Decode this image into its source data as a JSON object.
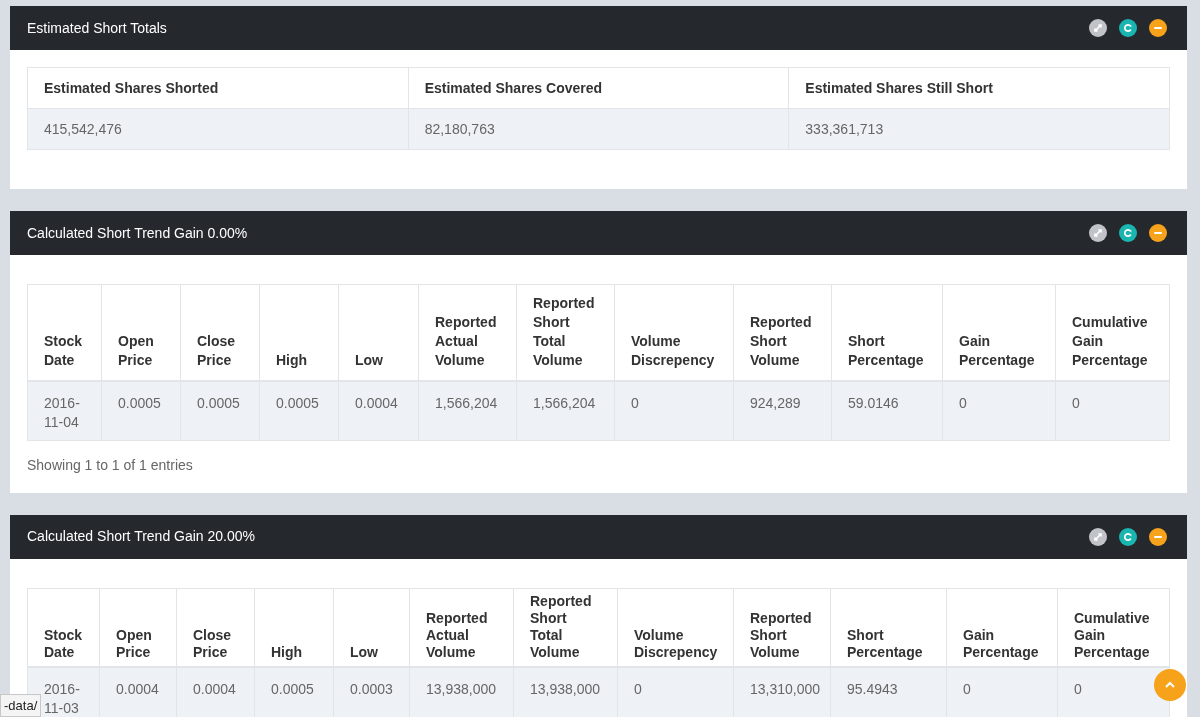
{
  "panels": [
    {
      "title": "Estimated Short Totals",
      "kind": "totals",
      "columns": [
        "Estimated Shares Shorted",
        "Estimated Shares Covered",
        "Estimated Shares Still Short"
      ],
      "rows": [
        [
          "415,542,476",
          "82,180,763",
          "333,361,713"
        ]
      ]
    },
    {
      "title": "Calculated Short Trend Gain 0.00%",
      "kind": "trend",
      "columns": [
        "Stock Date",
        "Open Price",
        "Close Price",
        "High",
        "Low",
        "Reported Actual Volume",
        "Reported Short Total Volume",
        "Volume Discrepency",
        "Reported Short Volume",
        "Short Percentage",
        "Gain Percentage",
        "Cumulative Gain Percentage"
      ],
      "rows": [
        [
          "2016-11-04",
          "0.0005",
          "0.0005",
          "0.0005",
          "0.0004",
          "1,566,204",
          "1,566,204",
          "0",
          "924,289",
          "59.0146",
          "0",
          "0"
        ]
      ],
      "footer": "Showing 1 to 1 of 1 entries"
    },
    {
      "title": "Calculated Short Trend Gain 20.00%",
      "kind": "trend",
      "columns": [
        "Stock Date",
        "Open Price",
        "Close Price",
        "High",
        "Low",
        "Reported Actual Volume",
        "Reported Short Total Volume",
        "Volume Discrepency",
        "Reported Short Volume",
        "Short Percentage",
        "Gain Percentage",
        "Cumulative Gain Percentage"
      ],
      "rows": [
        [
          "2016-11-03",
          "0.0004",
          "0.0004",
          "0.0005",
          "0.0003",
          "13,938,000",
          "13,938,000",
          "0",
          "13,310,000",
          "95.4943",
          "0",
          "0"
        ]
      ]
    }
  ],
  "status_url": "-data/"
}
